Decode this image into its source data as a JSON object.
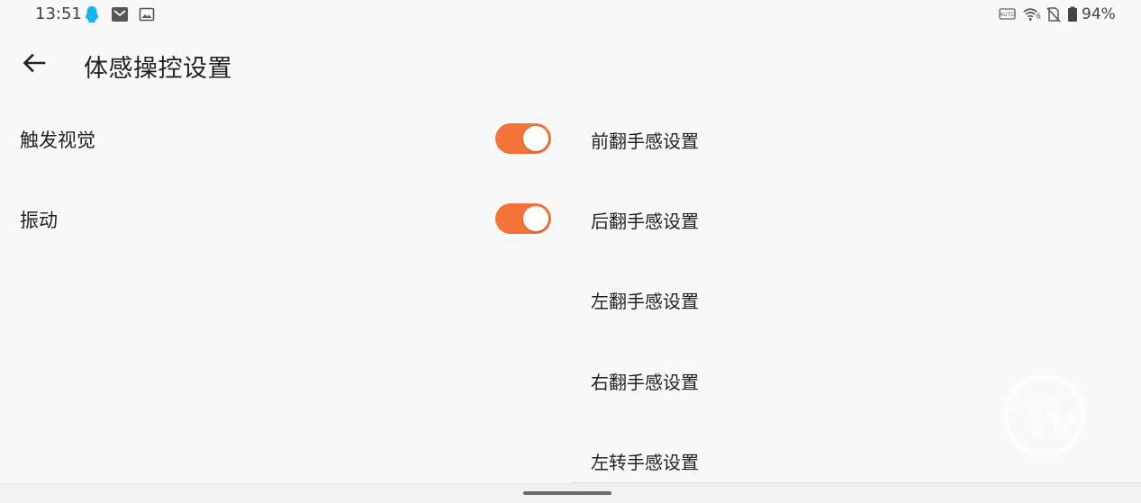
{
  "status_bar": {
    "time": "13:51",
    "left_icons": [
      "qq-icon",
      "mail-icon",
      "image-icon"
    ],
    "right_icons": [
      "auto-brightness-icon",
      "wifi-6-icon",
      "no-sim-icon",
      "battery-icon"
    ],
    "battery": "94%"
  },
  "header": {
    "title": "体感操控设置"
  },
  "settings": [
    {
      "label": "触发视觉",
      "enabled": true
    },
    {
      "label": "振动",
      "enabled": true
    }
  ],
  "list": [
    {
      "label": "前翻手感设置"
    },
    {
      "label": "后翻手感设置"
    },
    {
      "label": "左翻手感设置"
    },
    {
      "label": "右翻手感设置"
    },
    {
      "label": "左转手感设置"
    }
  ],
  "colors": {
    "accent": "#f3743a",
    "background": "#f9f9f9",
    "qq_icon": "#18b4ec"
  }
}
